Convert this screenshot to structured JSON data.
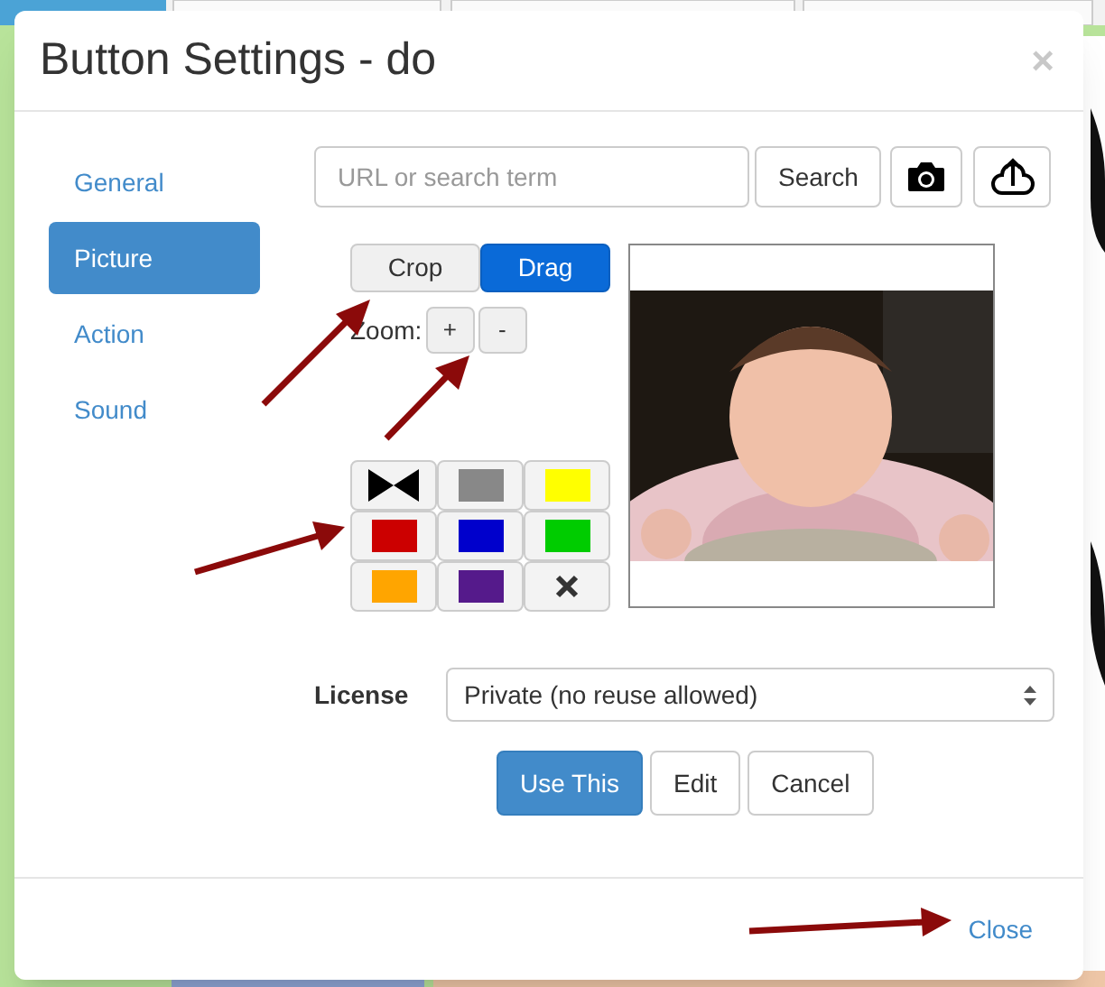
{
  "dialog": {
    "title": "Button Settings - do",
    "close_glyph": "×"
  },
  "nav": [
    {
      "label": "General",
      "selected": false
    },
    {
      "label": "Picture",
      "selected": true
    },
    {
      "label": "Action",
      "selected": false
    },
    {
      "label": "Sound",
      "selected": false
    }
  ],
  "search": {
    "placeholder": "URL or search term",
    "button": "Search"
  },
  "mode": [
    {
      "label": "Crop",
      "selected": false
    },
    {
      "label": "Drag",
      "selected": true
    }
  ],
  "zoom": {
    "label": "Zoom:",
    "buttons": [
      "+",
      "-"
    ]
  },
  "swatches": [
    {
      "kind": "bowtie"
    },
    {
      "kind": "color",
      "color": "#888888"
    },
    {
      "kind": "color",
      "color": "#ffff00"
    },
    {
      "kind": "color",
      "color": "#cc0000"
    },
    {
      "kind": "color",
      "color": "#0000cc"
    },
    {
      "kind": "color",
      "color": "#00cc00"
    },
    {
      "kind": "color",
      "color": "#ffa500"
    },
    {
      "kind": "color",
      "color": "#551a8b"
    },
    {
      "kind": "clear"
    }
  ],
  "license": {
    "label": "License",
    "value": "Private (no reuse allowed)"
  },
  "actions": [
    {
      "label": "Use This",
      "primary": true
    },
    {
      "label": "Edit",
      "primary": false
    },
    {
      "label": "Cancel",
      "primary": false
    }
  ],
  "footer": {
    "close": "Close"
  }
}
